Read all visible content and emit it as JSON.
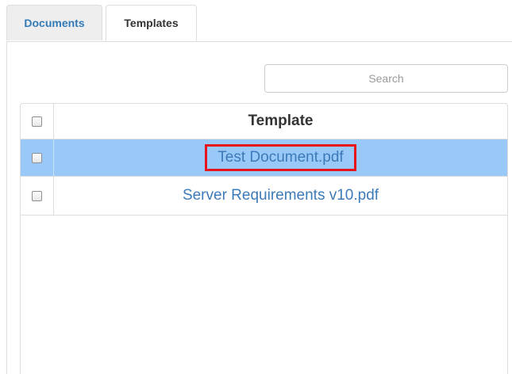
{
  "tabs": {
    "documents_label": "Documents",
    "templates_label": "Templates",
    "active": "Templates"
  },
  "search": {
    "placeholder": "Search",
    "value": ""
  },
  "table": {
    "header": "Template",
    "rows": [
      {
        "name": "Test Document.pdf",
        "selected": true,
        "highlighted": true
      },
      {
        "name": "Server Requirements v10.pdf",
        "selected": false,
        "highlighted": false
      }
    ]
  },
  "colors": {
    "link": "#3d7ab8",
    "selected_row": "#99c9f9",
    "highlight_border": "#e8141c"
  }
}
